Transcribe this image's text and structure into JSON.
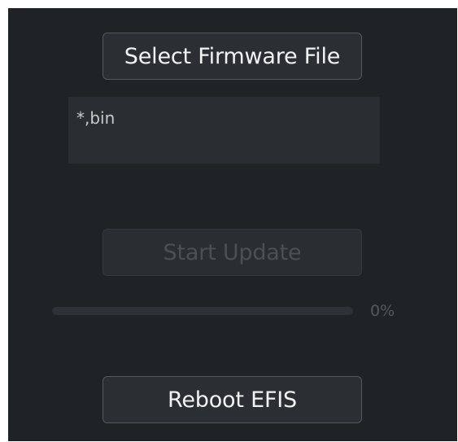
{
  "buttons": {
    "select_firmware": "Select Firmware File",
    "start_update": "Start Update",
    "reboot": "Reboot EFIS"
  },
  "file_filter": {
    "text": "*,bin"
  },
  "progress": {
    "value": 0,
    "label": "0%"
  }
}
